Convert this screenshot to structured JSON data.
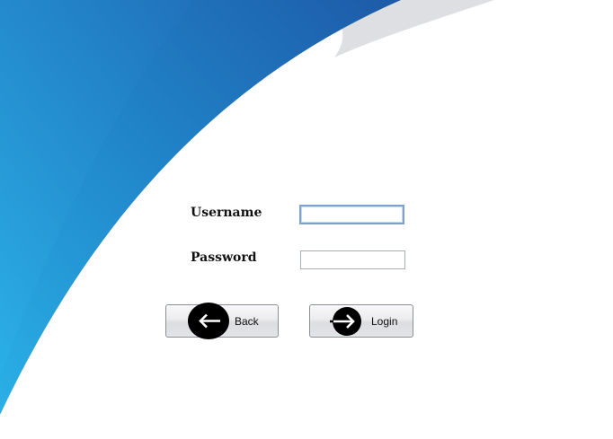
{
  "colors": {
    "background": "#ffffff",
    "swoosh_blue_dark": "#1f5fab",
    "swoosh_blue_light": "#2aa6df",
    "swoosh_grey": "#d7d9dd",
    "label_text": "#111111"
  },
  "login_form": {
    "username_label": "Username",
    "password_label": "Password",
    "username_value": "",
    "password_value": "",
    "back_button": {
      "label": "Back",
      "icon": "arrow-left-icon"
    },
    "login_button": {
      "label": "Login",
      "icon": "arrow-right-icon"
    }
  }
}
